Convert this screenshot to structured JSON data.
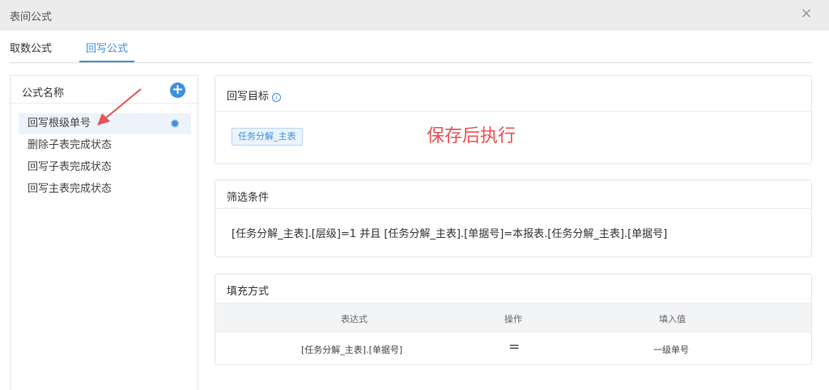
{
  "window": {
    "title": "表间公式",
    "close_glyph": "×"
  },
  "tabs": [
    {
      "label": "取数公式",
      "active": false
    },
    {
      "label": "回写公式",
      "active": true
    }
  ],
  "formula_list": {
    "header": "公式名称",
    "add_glyph": "+",
    "items": [
      {
        "label": "回写根级单号",
        "active": true
      },
      {
        "label": "删除子表完成状态",
        "active": false
      },
      {
        "label": "回写子表完成状态",
        "active": false
      },
      {
        "label": "回写主表完成状态",
        "active": false
      }
    ]
  },
  "target": {
    "header": "回写目标",
    "info_glyph": "i",
    "tag": "任务分解_主表",
    "annotation": "保存后执行"
  },
  "filter": {
    "header": "筛选条件",
    "condition": "[任务分解_主表].[层级]=1 并且 [任务分解_主表].[单据号]=本报表.[任务分解_主表].[单据号]"
  },
  "fill": {
    "header": "填充方式",
    "columns": [
      "表达式",
      "操作",
      "填入值"
    ],
    "rows": [
      {
        "expression": "[任务分解_主表].[单据号]",
        "operator": "=",
        "value": "一级单号"
      }
    ]
  },
  "colors": {
    "accent": "#3f90e0",
    "annotation": "#e85454"
  },
  "icons": {
    "add": "plus-circle-icon",
    "settings": "gear-icon",
    "info": "info-icon",
    "close": "close-icon"
  }
}
